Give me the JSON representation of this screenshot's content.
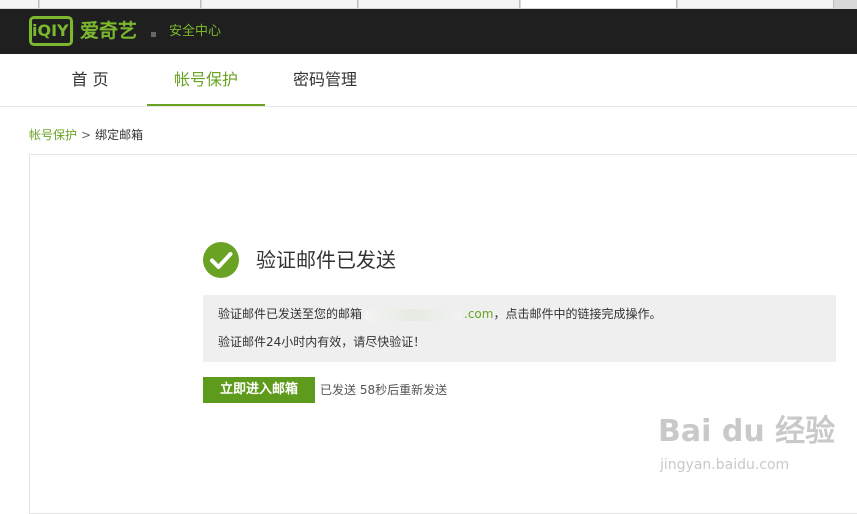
{
  "header": {
    "logo_text": "iQIYI",
    "brand": "爱奇艺",
    "section_title": "安全中心"
  },
  "nav": {
    "items": [
      {
        "label": "首 页"
      },
      {
        "label": "帐号保护"
      },
      {
        "label": "密码管理"
      }
    ],
    "active_index": 1
  },
  "breadcrumb": {
    "parent": "帐号保护",
    "separator": ">",
    "current": "绑定邮箱"
  },
  "main": {
    "title": "验证邮件已发送",
    "notice_line1_prefix": "验证邮件已发送至您的邮箱",
    "notice_email_visible": ".com",
    "notice_line1_suffix": "，点击邮件中的链接完成操作。",
    "notice_line2": "验证邮件24小时内有效，请尽快验证！",
    "button_label": "立即进入邮箱",
    "resend_text": "已发送 58秒后重新发送"
  },
  "watermark": {
    "main": "Bai du 经验",
    "sub": "jingyan.baidu.com"
  },
  "colors": {
    "accent": "#6aa323",
    "header_bg": "#1f1f1f",
    "notice_bg": "#efefef"
  }
}
